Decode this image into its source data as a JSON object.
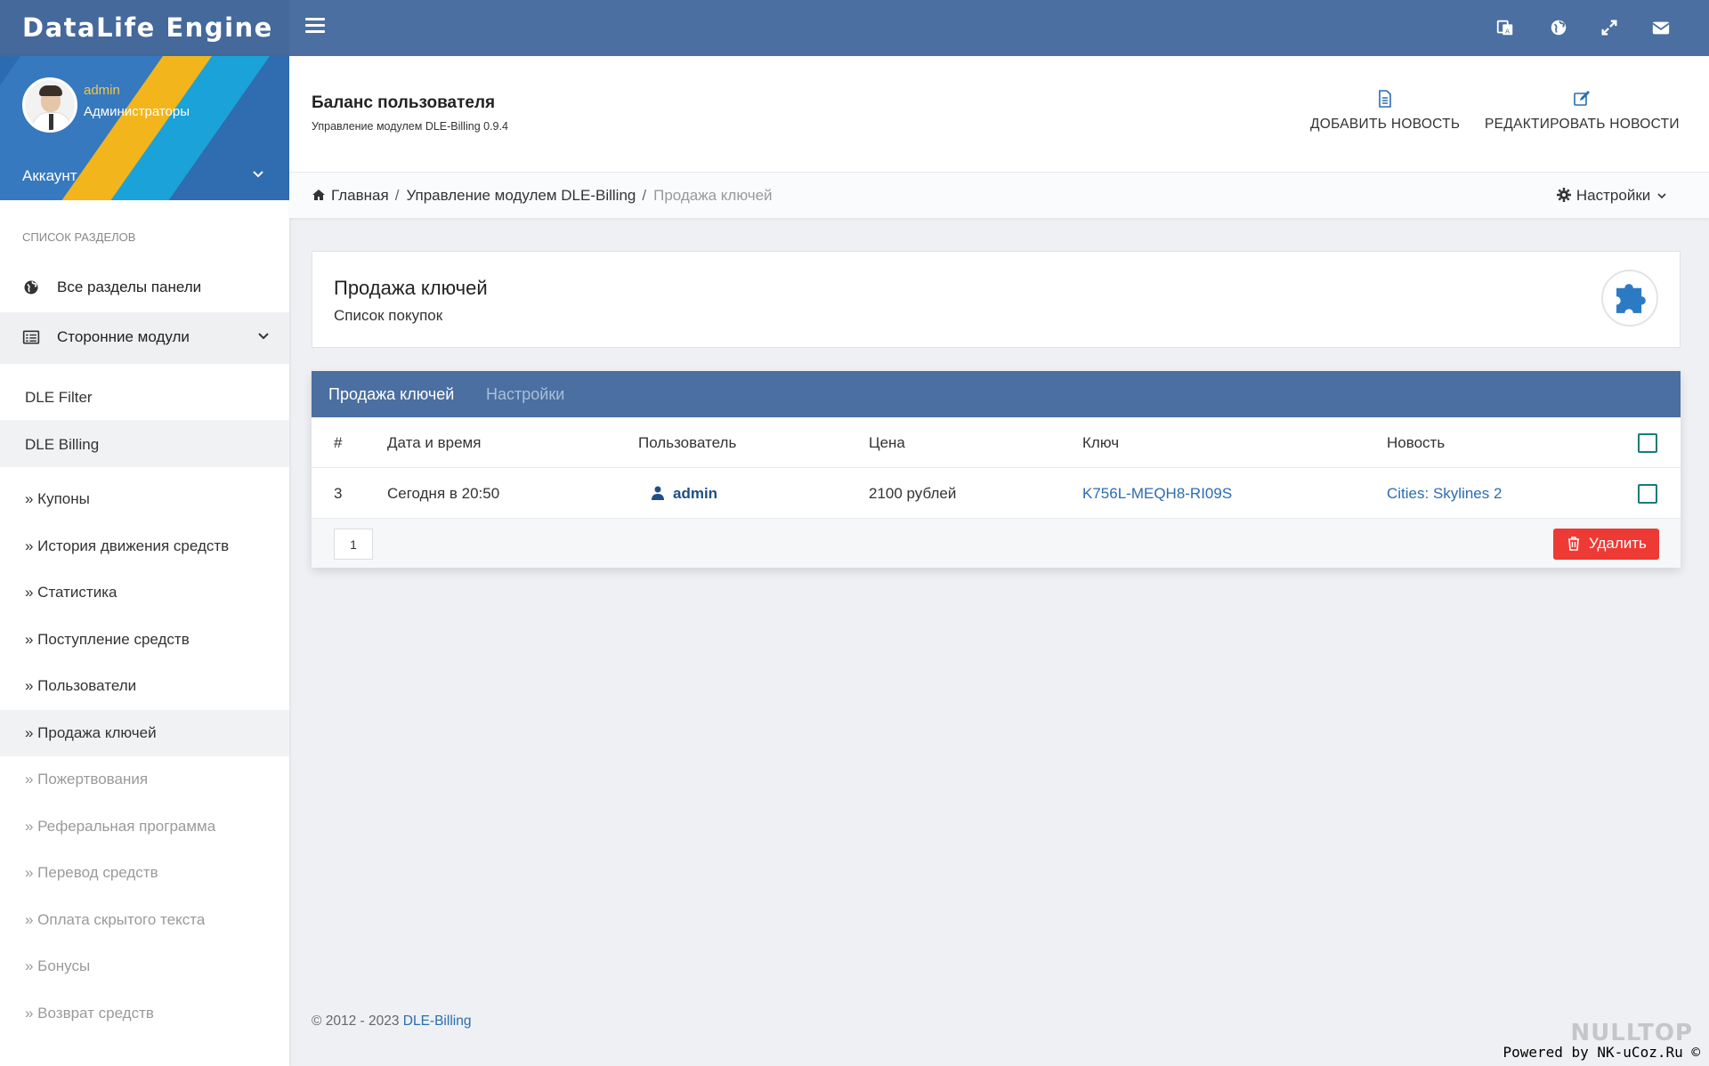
{
  "brand": "DataLife Engine",
  "user": {
    "name": "admin",
    "group": "Администраторы",
    "account_label": "Аккаунт"
  },
  "sidebar": {
    "section_title": "СПИСОК РАЗДЕЛОВ",
    "all_sections": "Все разделы панели",
    "third_party": "Сторонние модули",
    "modules": [
      "DLE Filter",
      "DLE Billing"
    ],
    "links": [
      "» Купоны",
      "» История движения средств",
      "» Статистика",
      "» Поступление средств",
      "» Пользователи",
      "» Продажа ключей",
      "» Пожертвования",
      "» Реферальная программа",
      "» Перевод средств",
      "» Оплата скрытого текста",
      "» Бонусы",
      "» Возврат средств"
    ]
  },
  "header": {
    "title": "Баланс пользователя",
    "subtitle": "Управление модулем DLE-Billing 0.9.4",
    "add_news": "ДОБАВИТЬ НОВОСТЬ",
    "edit_news": "РЕДАКТИРОВАТЬ НОВОСТИ"
  },
  "breadcrumb": {
    "home": "Главная",
    "module": "Управление модулем DLE-Billing",
    "current": "Продажа ключей",
    "settings": "Настройки"
  },
  "info": {
    "title": "Продажа ключей",
    "subtitle": "Список покупок"
  },
  "tabs": {
    "active": "Продажа ключей",
    "inactive": "Настройки"
  },
  "table": {
    "headers": {
      "num": "#",
      "date": "Дата и время",
      "user": "Пользователь",
      "price": "Цена",
      "key": "Ключ",
      "news": "Новость"
    },
    "rows": [
      {
        "num": "3",
        "date": "Сегодня в 20:50",
        "user": "admin",
        "price": "2100 рублей",
        "key": "K756L-MEQH8-RI09S",
        "news": "Cities: Skylines 2"
      }
    ],
    "page": "1",
    "delete_label": "Удалить"
  },
  "footer": {
    "copyright": "© 2012 - 2023",
    "copyright_link": "DLE-Billing",
    "powered": "Powered by NK-uCoz.Ru ©",
    "watermark": "NULLTOP"
  },
  "colors": {
    "topbar": "#4a6fa0",
    "accent": "#2b6cb0",
    "danger": "#ee3a35",
    "checkbox": "#1a7a7a"
  }
}
